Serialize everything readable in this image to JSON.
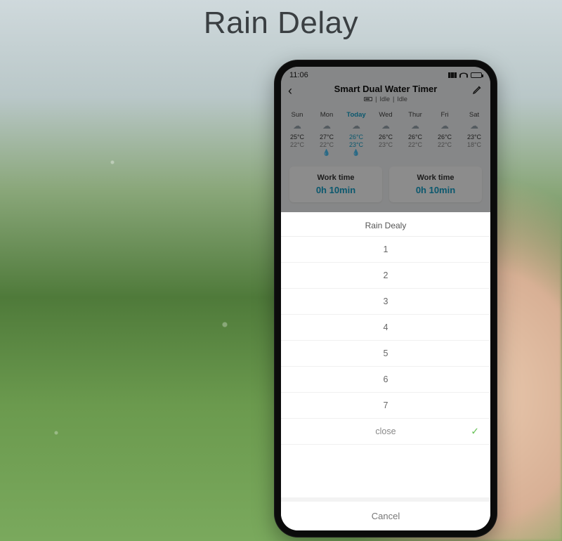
{
  "page_title": "Rain Delay",
  "status": {
    "time": "11:06",
    "location_icon": true
  },
  "header": {
    "title": "Smart Dual Water Timer",
    "status1": "Idle",
    "status2": "Idle"
  },
  "forecast": [
    {
      "label": "Sun",
      "hi": "25°C",
      "lo": "22°C",
      "drop": false
    },
    {
      "label": "Mon",
      "hi": "27°C",
      "lo": "22°C",
      "drop": true
    },
    {
      "label": "Today",
      "hi": "26°C",
      "lo": "23°C",
      "drop": true
    },
    {
      "label": "Wed",
      "hi": "26°C",
      "lo": "23°C",
      "drop": false
    },
    {
      "label": "Thur",
      "hi": "26°C",
      "lo": "22°C",
      "drop": false
    },
    {
      "label": "Fri",
      "hi": "26°C",
      "lo": "22°C",
      "drop": false
    },
    {
      "label": "Sat",
      "hi": "23°C",
      "lo": "18°C",
      "drop": false
    }
  ],
  "cards": [
    {
      "title": "Work time",
      "value": "0h 10min"
    },
    {
      "title": "Work time",
      "value": "0h 10min"
    }
  ],
  "sheet": {
    "title": "Rain Dealy",
    "options": [
      "1",
      "2",
      "3",
      "4",
      "5",
      "6",
      "7",
      "close"
    ],
    "selected_index": 7,
    "cancel": "Cancel"
  }
}
